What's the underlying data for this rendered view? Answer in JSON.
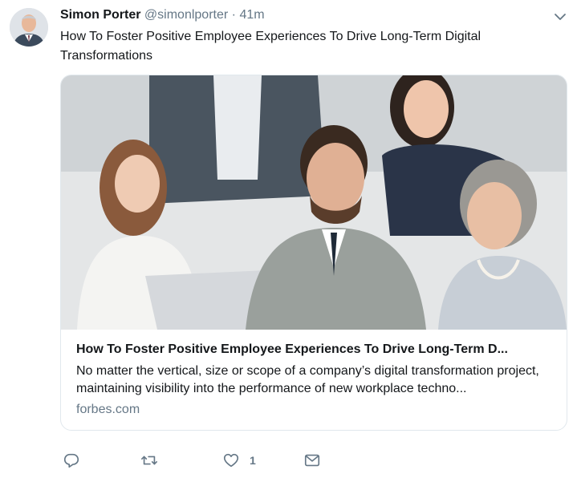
{
  "tweet": {
    "author_name": "Simon Porter",
    "author_handle": "@simonlporter",
    "separator": "·",
    "timestamp": "41m",
    "text": "How To Foster Positive Employee Experiences To Drive Long-Term Digital Transformations"
  },
  "card": {
    "title": "How To Foster Positive Employee Experiences To Drive Long-Term D...",
    "description": "No matter the vertical, size or scope of a company’s digital transformation project, maintaining visibility into the performance of new workplace techno...",
    "domain": "forbes.com"
  },
  "actions": {
    "reply_icon": "reply-icon",
    "retweet_icon": "retweet-icon",
    "like_icon": "heart-icon",
    "like_count": "1",
    "dm_icon": "envelope-icon"
  },
  "colors": {
    "text": "#14171a",
    "secondary": "#657786",
    "border": "#e1e8ed"
  }
}
